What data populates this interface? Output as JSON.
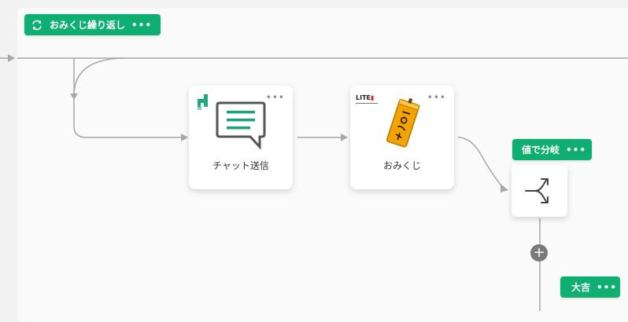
{
  "loop_tag": {
    "label": "おみくじ繰り返し",
    "more": "•••",
    "icon": "refresh-icon"
  },
  "nodes": {
    "chat": {
      "title": "チャット送信",
      "more": "•••",
      "icon": "chat-bubble-icon",
      "logo": "d-logo"
    },
    "omikuji": {
      "title": "おみくじ",
      "more": "•••",
      "icon": "omikuji-box-icon",
      "logo": "LITE"
    },
    "branch": {
      "icon": "branch-split-icon"
    }
  },
  "branch_tag": {
    "label": "値で分岐",
    "more": "•••"
  },
  "result_tag": {
    "label": "大吉",
    "more": "•••"
  },
  "colors": {
    "accent": "#0fae73",
    "wire": "#a8a8a8",
    "plus": "#7a7a7a"
  }
}
